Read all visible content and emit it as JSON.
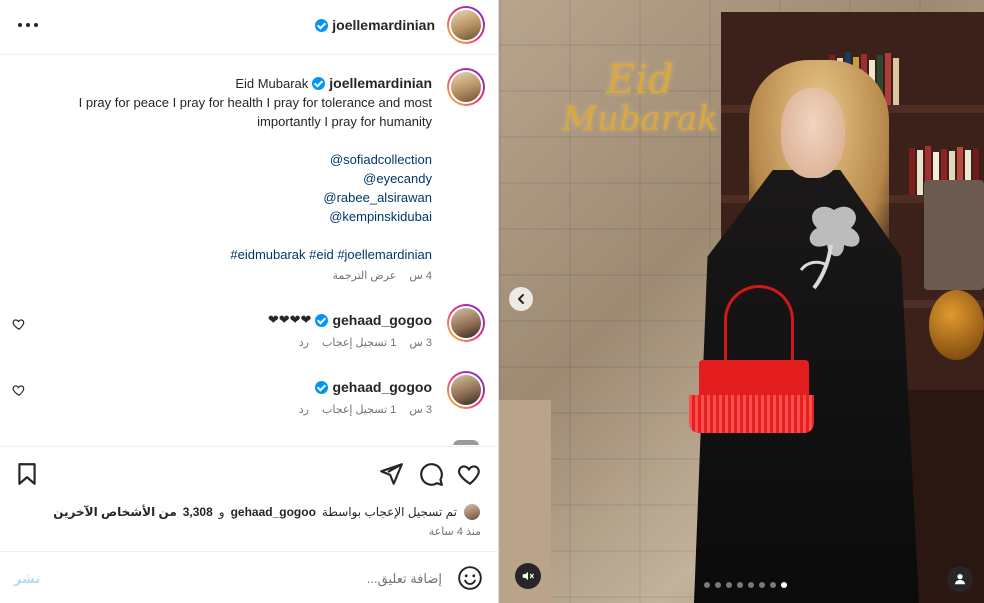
{
  "header": {
    "username": "joellemardinian"
  },
  "caption": {
    "title": "Eid Mubarak",
    "username": "joellemardinian",
    "line1": "I pray for peace I pray for health I pray for tolerance and most",
    "line2": "importantly I pray for humanity",
    "mentions": [
      "@sofiadcollection",
      "@eyecandy",
      "@rabee_alsirawan",
      "@kempinskidubai"
    ],
    "mention_prefix": "",
    "hashtags": "#eidmubarak #eid #joellemardinian",
    "time": "4 س",
    "translate": "عرض الترجمة"
  },
  "comments": [
    {
      "username": "gehaad_gogoo",
      "text": "❤❤❤❤",
      "time": "3 س",
      "likes": "1 تسجيل إعجاب",
      "reply": "رد"
    },
    {
      "username": "gehaad_gogoo",
      "text": "",
      "time": "3 س",
      "likes": "1 تسجيل إعجاب",
      "reply": "رد"
    }
  ],
  "likes_summary": {
    "prefix": "تم تسجيل الإعجاب بواسطة",
    "user": "gehaad_gogoo",
    "middle": "و",
    "count": "3,308",
    "suffix": "من الأشخاص الآخرين"
  },
  "time_ago": "منذ 4 ساعة",
  "comment_box": {
    "placeholder": "إضافة تعليق...",
    "post_label": "نشر"
  },
  "media": {
    "overlay_title_1": "Eid",
    "overlay_title_2": "Mubarak",
    "slide_count": 8,
    "active_slide": 7
  },
  "colors": {
    "verified": "#0095f6",
    "link": "#00376b",
    "post_disabled": "#b3dbff",
    "bag": "#e31d1d"
  },
  "icons": [
    "more-icon",
    "verified-icon",
    "heart-icon",
    "comment-icon",
    "share-icon",
    "save-icon",
    "emoji-icon",
    "chevron-left-icon",
    "mute-icon",
    "user-tag-icon"
  ]
}
